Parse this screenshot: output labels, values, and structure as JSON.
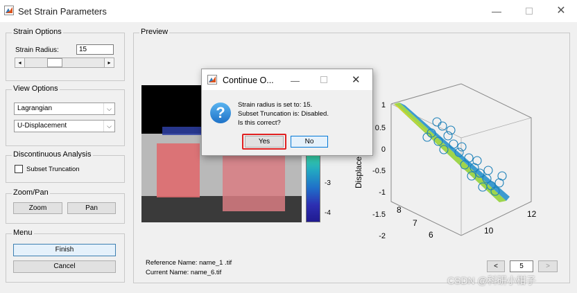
{
  "window": {
    "title": "Set Strain Parameters"
  },
  "strain_options": {
    "title": "Strain Options",
    "radius_label": "Strain Radius:",
    "radius_value": "15",
    "slider_level": 0.35
  },
  "view_options": {
    "title": "View Options",
    "config_selected": "Lagrangian",
    "variable_selected": "U-Displacement"
  },
  "discontinuous": {
    "title": "Discontinuous Analysis",
    "subset_truncation_label": "Subset Truncation",
    "subset_truncation_checked": false
  },
  "zoom_pan": {
    "title": "Zoom/Pan",
    "zoom_label": "Zoom",
    "pan_label": "Pan"
  },
  "menu": {
    "title": "Menu",
    "finish_label": "Finish",
    "cancel_label": "Cancel"
  },
  "preview": {
    "title": "Preview",
    "reference_name": "Reference Name: name_1 .tif",
    "current_name": "Current Name: name_6.tif",
    "colorbar_ticks": [
      "-3",
      "-4"
    ],
    "colorbar_top_tick": "-",
    "plot3d": {
      "z_ticks": [
        "1",
        "0.5",
        "0",
        "-0.5",
        "-1",
        "-1.5",
        "-2"
      ],
      "z_label": "Displace",
      "y_ticks": [
        "8",
        "7",
        "6"
      ],
      "x_ticks": [
        "12",
        "10"
      ]
    },
    "page": {
      "prev_label": "<",
      "next_label": ">",
      "value": "5"
    }
  },
  "dialog": {
    "title": "Continue O...",
    "message_lines": [
      "Strain radius is set to: 15.",
      "Subset Truncation is: Disabled.",
      "Is this correct?"
    ],
    "yes_label": "Yes",
    "no_label": "No"
  },
  "watermark": "CSDN @科研小柑子",
  "colors": {
    "highlight_red": "#e02020",
    "accent_blue": "#0078d7"
  }
}
